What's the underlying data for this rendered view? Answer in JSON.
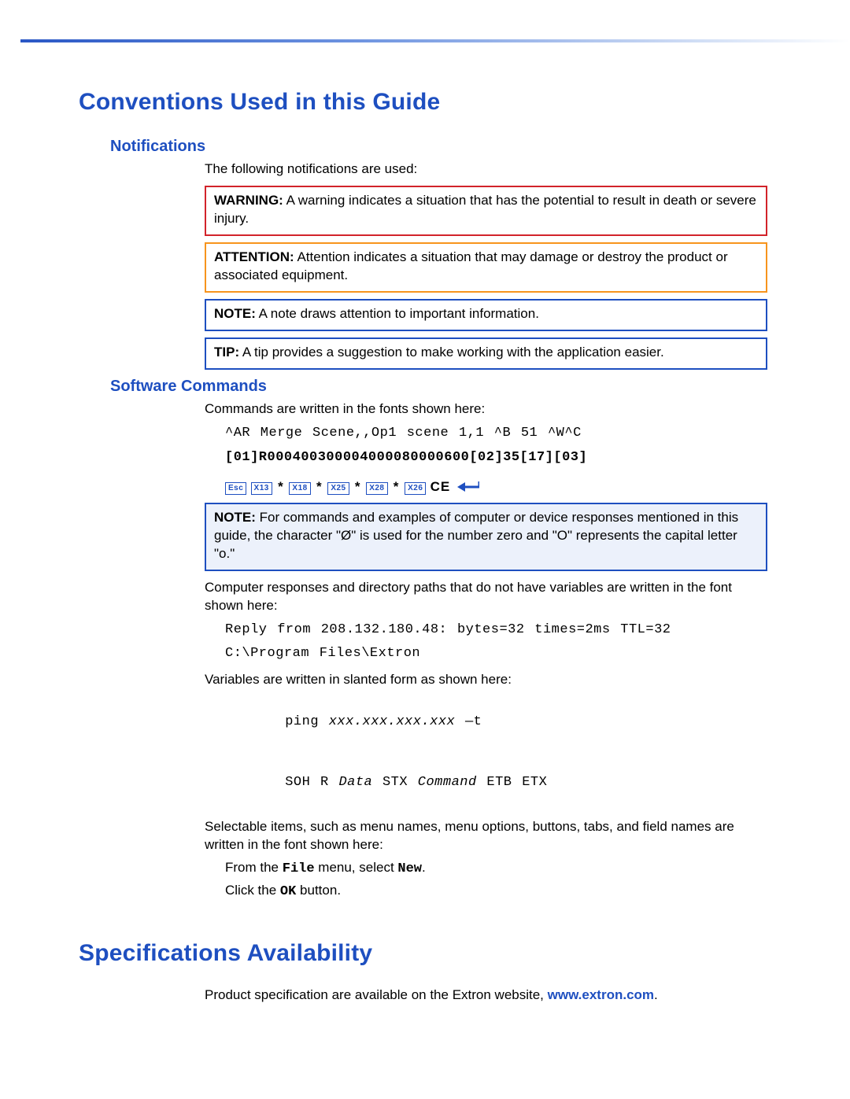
{
  "h1_conventions": "Conventions Used in this Guide",
  "h2_notifications": "Notifications",
  "notifications_intro": "The following notifications are used:",
  "warning_label": "WARNING:",
  "warning_text": " A warning indicates a situation that has the potential to result in death or severe injury.",
  "attention_label": "ATTENTION:",
  "attention_text": " Attention indicates a situation that may damage or destroy the product or associated equipment.",
  "note_label": "NOTE:",
  "note_text": " A note draws attention to important information.",
  "tip_label": "TIP:",
  "tip_text": " A tip provides a suggestion to make working with the application easier.",
  "h2_software": "Software Commands",
  "software_intro": "Commands are written in the fonts shown here:",
  "cmd_line": "^AR Merge Scene,,Op1 scene 1,1 ^B 51 ^W^C",
  "hex_line": "[01]R000400300004000080000600[02]35[17][03]",
  "key_esc": "Esc",
  "key_x13": "X13",
  "key_x18": "X18",
  "key_x25": "X25",
  "key_x28": "X28",
  "key_x26": "X26",
  "ce_txt": "CE",
  "note2_label": "NOTE:",
  "note2_text": " For commands and examples of computer or device responses mentioned in this guide, the character \"Ø\" is used for the number zero and \"O\" represents the capital letter \"o.\"",
  "body_resp_intro": "Computer responses and directory paths that do not have variables are written in the font shown here:",
  "reply_line": "Reply from 208.132.180.48: bytes=32 times=2ms TTL=32",
  "path_line": "C:\\Program Files\\Extron",
  "vars_intro": "Variables are written in slanted form as shown here:",
  "ping_pre": "ping ",
  "ping_var": "xxx.xxx.xxx.xxx",
  "ping_post": " —t",
  "soh1": "SOH R ",
  "soh_data": "Data",
  "soh_mid": " STX ",
  "soh_cmd": "Command",
  "soh_end": " ETB ETX",
  "sel_intro": "Selectable items, such as menu names, menu options, buttons, tabs, and field names are written in the font shown here:",
  "from_the": "From the ",
  "file_txt": "File",
  "menu_sel": " menu, select ",
  "new_txt": "New",
  "dot": ".",
  "click_the": "Click the ",
  "ok_txt": "OK",
  "button_txt": " button.",
  "h1_spec": "Specifications Availability",
  "spec_body": "Product specification are available on the Extron website, ",
  "spec_link": "www.extron.com"
}
